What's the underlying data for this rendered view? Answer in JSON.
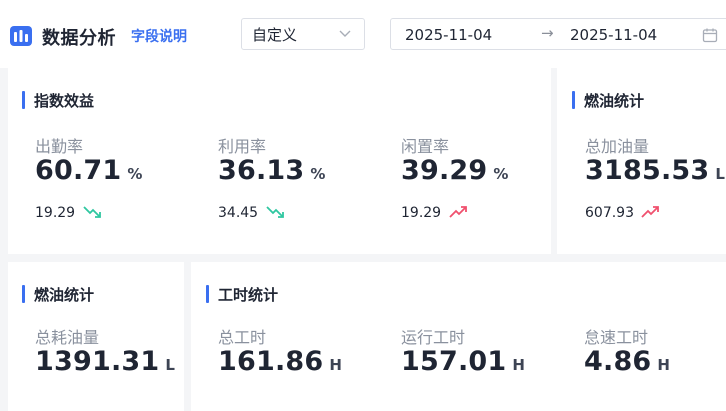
{
  "header": {
    "title": "数据分析",
    "field_help": "字段说明",
    "range_select": {
      "value": "自定义"
    },
    "date_range": {
      "start": "2025-11-04",
      "separator": "→",
      "end": "2025-11-04"
    }
  },
  "cards": {
    "efficiency": {
      "title": "指数效益",
      "metrics": [
        {
          "label": "出勤率",
          "value": "60.71",
          "unit": "%",
          "sub": "19.29",
          "trend": "down"
        },
        {
          "label": "利用率",
          "value": "36.13",
          "unit": "%",
          "sub": "34.45",
          "trend": "down"
        },
        {
          "label": "闲置率",
          "value": "39.29",
          "unit": "%",
          "sub": "19.29",
          "trend": "up"
        }
      ]
    },
    "fuel_top": {
      "title": "燃油统计",
      "metrics": [
        {
          "label": "总加油量",
          "value": "3185.53",
          "unit": "L",
          "sub": "607.93",
          "trend": "up"
        }
      ]
    },
    "fuel_bottom": {
      "title": "燃油统计",
      "metrics": [
        {
          "label": "总耗油量",
          "value": "1391.31",
          "unit": "L"
        }
      ]
    },
    "work_hours": {
      "title": "工时统计",
      "metrics": [
        {
          "label": "总工时",
          "value": "161.86",
          "unit": "H"
        },
        {
          "label": "运行工时",
          "value": "157.01",
          "unit": "H"
        },
        {
          "label": "怠速工时",
          "value": "4.86",
          "unit": "H"
        }
      ]
    }
  },
  "colors": {
    "accent": "#3a6ff0",
    "trend_down": "#2fc7a0",
    "trend_up": "#f0506e"
  }
}
